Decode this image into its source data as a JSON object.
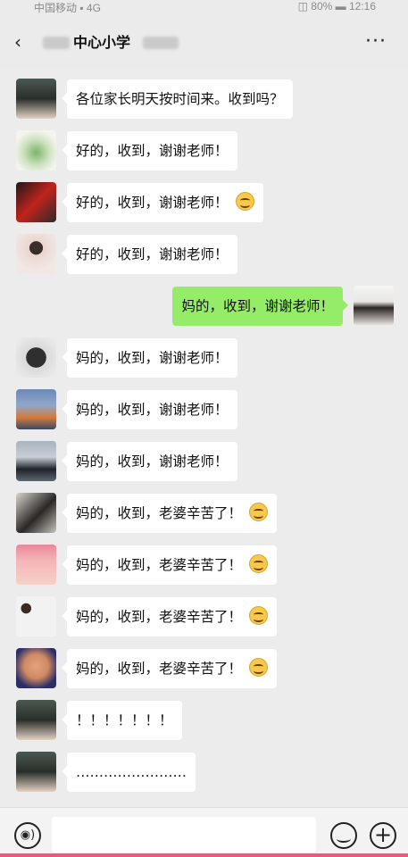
{
  "status_bar": {
    "carrier": "中国移动 ▪ 4G",
    "right": "◫ 80% ▬ 12:16"
  },
  "header": {
    "title": "中心小学",
    "back_icon": "back-arrow-icon",
    "more_icon": "more-icon",
    "more_glyph": "···"
  },
  "messages": [
    {
      "side": "left",
      "text": "各位家长明天按时间来。收到吗？",
      "emoji": false
    },
    {
      "side": "left",
      "text": "好的，收到，谢谢老师！",
      "emoji": false
    },
    {
      "side": "left",
      "text": "好的，收到，谢谢老师！",
      "emoji": true
    },
    {
      "side": "left",
      "text": "好的，收到，谢谢老师！",
      "emoji": false
    },
    {
      "side": "right",
      "text": "妈的，收到，谢谢老师！",
      "emoji": false
    },
    {
      "side": "left",
      "text": "妈的，收到，谢谢老师！",
      "emoji": false
    },
    {
      "side": "left",
      "text": "妈的，收到，谢谢老师！",
      "emoji": false
    },
    {
      "side": "left",
      "text": "妈的，收到，谢谢老师！",
      "emoji": false
    },
    {
      "side": "left",
      "text": "妈的，收到，老婆辛苦了！",
      "emoji": true
    },
    {
      "side": "left",
      "text": "妈的，收到，老婆辛苦了！",
      "emoji": true
    },
    {
      "side": "left",
      "text": "妈的，收到，老婆辛苦了！",
      "emoji": true
    },
    {
      "side": "left",
      "text": "妈的，收到，老婆辛苦了！",
      "emoji": true
    },
    {
      "side": "left",
      "text": "！！！！！！！",
      "emoji": false
    },
    {
      "side": "left",
      "text": "……………………",
      "emoji": false
    }
  ],
  "input_bar": {
    "voice_icon": "voice-icon",
    "emoji_icon": "emoji-icon",
    "plus_icon": "plus-icon",
    "voice_glyph": "◉)",
    "plus_glyph": "+"
  },
  "colors": {
    "sent_bubble": "#95ec69",
    "received_bubble": "#ffffff",
    "background": "#ececec"
  }
}
